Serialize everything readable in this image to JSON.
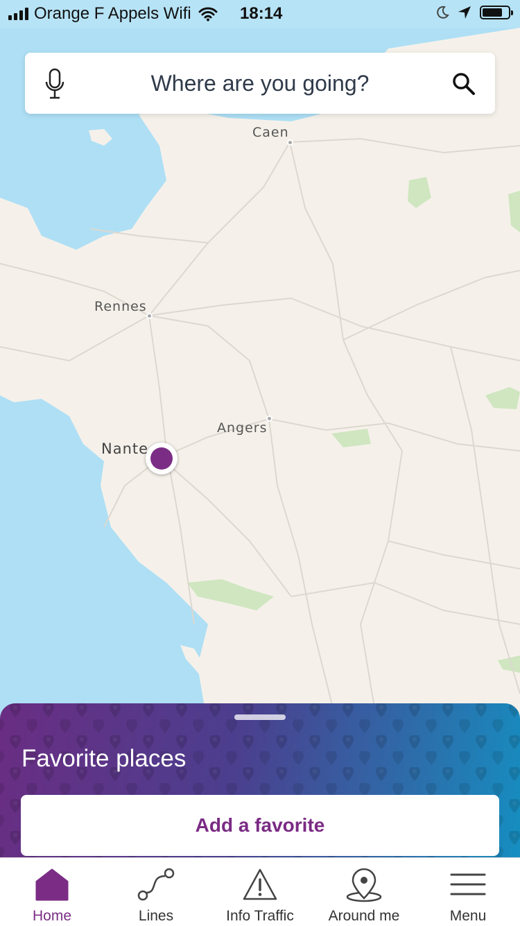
{
  "status_bar": {
    "carrier": "Orange F Appels Wifi",
    "time": "18:14",
    "icons": [
      "signal-icon",
      "wifi-icon",
      "moon-icon",
      "location-arrow-icon",
      "battery-icon"
    ]
  },
  "search": {
    "placeholder": "Where are you going?",
    "left_icon": "microphone-icon",
    "right_icon": "search-icon"
  },
  "map": {
    "cities": [
      "Caen",
      "Rennes",
      "Angers",
      "Nante"
    ],
    "current_location_color": "#7b2d86"
  },
  "favorites": {
    "title": "Favorite places",
    "add_label": "Add a favorite"
  },
  "tabbar": {
    "tabs": [
      {
        "label": "Home",
        "icon": "home-icon",
        "active": true
      },
      {
        "label": "Lines",
        "icon": "route-icon",
        "active": false
      },
      {
        "label": "Info Traffic",
        "icon": "warning-icon",
        "active": false
      },
      {
        "label": "Around me",
        "icon": "location-pin-icon",
        "active": false
      },
      {
        "label": "Menu",
        "icon": "menu-icon",
        "active": false
      }
    ]
  },
  "colors": {
    "accent": "#7b2d86",
    "sea": "#aedff5",
    "land": "#f5f1ea",
    "forest": "#cfe6c0"
  }
}
